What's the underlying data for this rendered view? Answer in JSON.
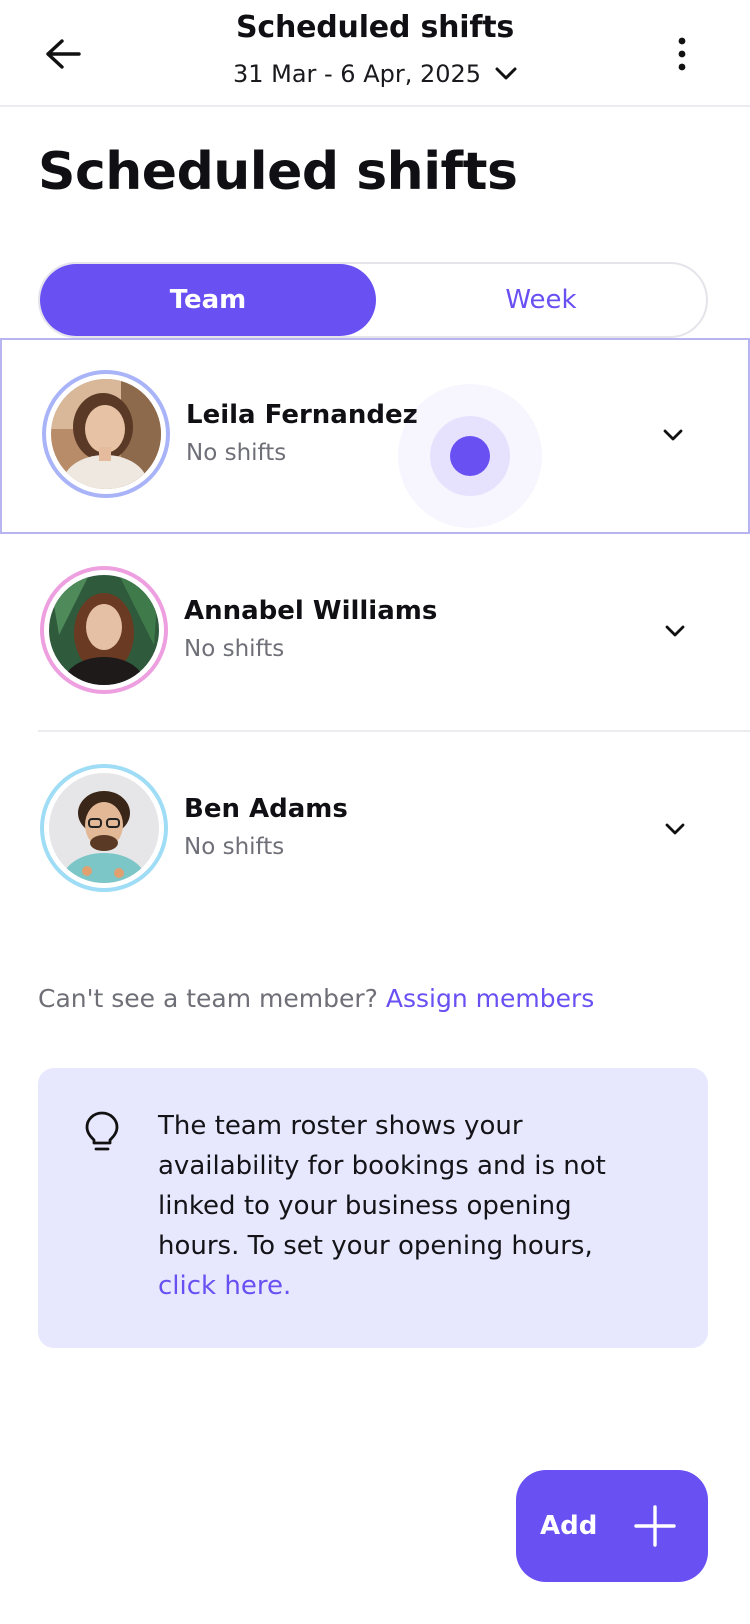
{
  "header": {
    "title": "Scheduled shifts",
    "date_range": "31 Mar - 6 Apr, 2025",
    "icons": {
      "back": "arrow-left-icon",
      "date_toggle": "chevron-down-icon",
      "more": "more-vertical-icon"
    }
  },
  "page": {
    "title": "Scheduled shifts"
  },
  "tabs": {
    "team": "Team",
    "week": "Week",
    "active": "Team"
  },
  "members": [
    {
      "name": "Leila Fernandez",
      "status": "No shifts",
      "ring_color": "#a9b4f8"
    },
    {
      "name": "Annabel Williams",
      "status": "No shifts",
      "ring_color": "#ee9fe0"
    },
    {
      "name": "Ben Adams",
      "status": "No shifts",
      "ring_color": "#9fdcf5"
    }
  ],
  "assign": {
    "question": "Can't see a team member? ",
    "link": "Assign members"
  },
  "info": {
    "icon": "lightbulb-icon",
    "text": "The team roster shows your availability for bookings and is not linked to your business opening hours. To set your opening hours, ",
    "link": "click here."
  },
  "fab": {
    "label": "Add",
    "icon": "plus-icon"
  },
  "colors": {
    "accent": "#6950f3",
    "info_bg": "#e7e7fd"
  }
}
